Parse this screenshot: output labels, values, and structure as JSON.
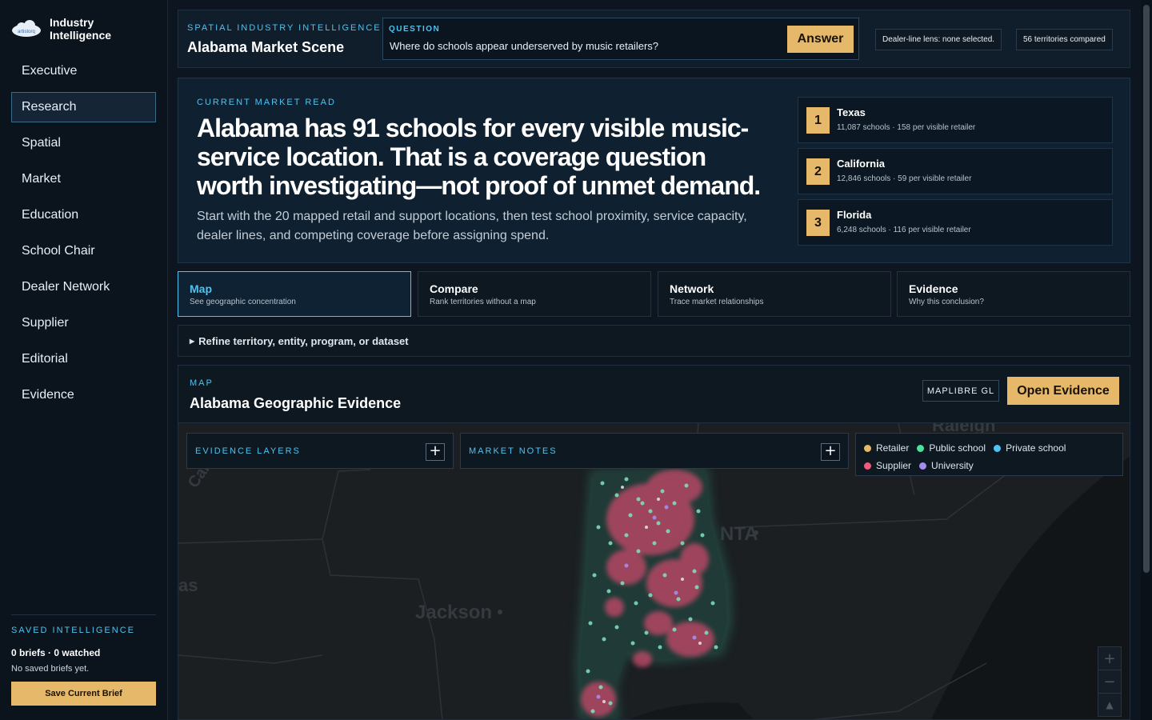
{
  "sidebar": {
    "brand": {
      "line1": "Industry",
      "line2": "Intelligence",
      "logo_text": "artistorq"
    },
    "nav": [
      {
        "label": "Executive",
        "active": false
      },
      {
        "label": "Research",
        "active": true
      },
      {
        "label": "Spatial",
        "active": false
      },
      {
        "label": "Market",
        "active": false
      },
      {
        "label": "Education",
        "active": false
      },
      {
        "label": "School Chair",
        "active": false
      },
      {
        "label": "Dealer Network",
        "active": false
      },
      {
        "label": "Supplier",
        "active": false
      },
      {
        "label": "Editorial",
        "active": false
      },
      {
        "label": "Evidence",
        "active": false
      }
    ],
    "saved": {
      "kicker": "SAVED INTELLIGENCE",
      "counts": "0 briefs · 0 watched",
      "empty": "No saved briefs yet.",
      "button": "Save Current Brief"
    }
  },
  "topbar": {
    "kicker": "SPATIAL INDUSTRY INTELLIGENCE",
    "scene": "Alabama Market Scene",
    "question_label": "QUESTION",
    "question": "Where do schools appear underserved by music retailers?",
    "answer_button": "Answer",
    "dealer_chip": "Dealer-line lens: none selected.",
    "territories_chip": "56 territories compared"
  },
  "hero": {
    "kicker": "CURRENT MARKET READ",
    "headline": "Alabama has 91 schools for every visible music-service location. That is a coverage question worth investigating—not proof of unmet demand.",
    "subtext": "Start with the 20 mapped retail and support locations, then test school proximity, service capacity, dealer lines, and competing coverage before assigning spend.",
    "rankings": [
      {
        "rank": "1",
        "name": "Texas",
        "stat": "11,087 schools · 158 per visible retailer"
      },
      {
        "rank": "2",
        "name": "California",
        "stat": "12,846 schools · 59 per visible retailer"
      },
      {
        "rank": "3",
        "name": "Florida",
        "stat": "6,248 schools · 116 per visible retailer"
      }
    ]
  },
  "tabs": [
    {
      "title": "Map",
      "desc": "See geographic concentration",
      "active": true
    },
    {
      "title": "Compare",
      "desc": "Rank territories without a map",
      "active": false
    },
    {
      "title": "Network",
      "desc": "Trace market relationships",
      "active": false
    },
    {
      "title": "Evidence",
      "desc": "Why this conclusion?",
      "active": false
    }
  ],
  "refine": "Refine territory, entity, program, or dataset",
  "map": {
    "kicker": "MAP",
    "title": "Alabama Geographic Evidence",
    "engine": "MAPLIBRE GL",
    "open_button": "Open Evidence",
    "layers_label": "EVIDENCE LAYERS",
    "notes_label": "MARKET NOTES",
    "legend": [
      {
        "label": "Retailer",
        "color": "#e6b86a"
      },
      {
        "label": "Public school",
        "color": "#4fe0a0"
      },
      {
        "label": "Private school",
        "color": "#4fc3f0"
      },
      {
        "label": "Supplier",
        "color": "#f05a7a"
      },
      {
        "label": "University",
        "color": "#a48cf0"
      }
    ],
    "basemap_labels": {
      "jackson": "Jackson",
      "atlanta": "NTA",
      "raleigh": "Raleigh",
      "partial_left": "as",
      "partial_arc": "Car"
    },
    "zoom": {
      "in": "+",
      "out": "−",
      "compass": "▲"
    }
  },
  "colors": {
    "accent": "#4fc3f0",
    "gold": "#e6b86a",
    "bg": "#0c1520"
  }
}
